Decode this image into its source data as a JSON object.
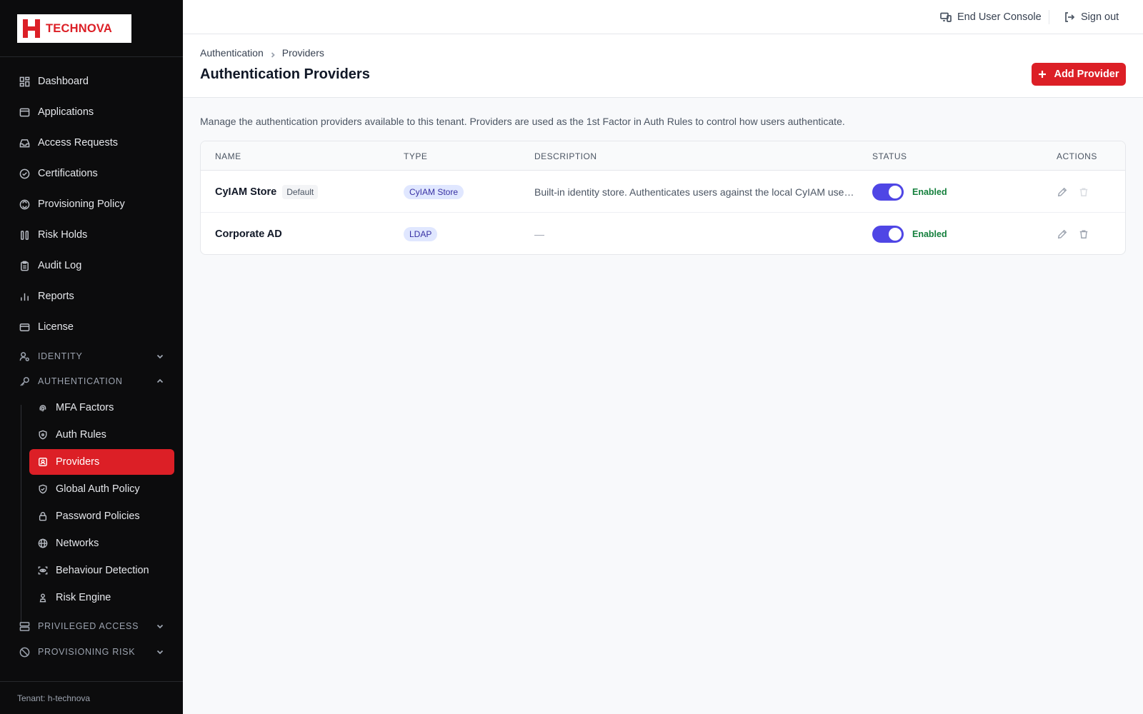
{
  "brand": {
    "name": "TECHNOVA",
    "color": "#dc1f26"
  },
  "sidebar": {
    "items": [
      {
        "label": "Dashboard",
        "icon": "dashboard-icon"
      },
      {
        "label": "Applications",
        "icon": "app-window-icon"
      },
      {
        "label": "Access Requests",
        "icon": "inbox-icon"
      },
      {
        "label": "Certifications",
        "icon": "check-circle-icon"
      },
      {
        "label": "Provisioning Policy",
        "icon": "policy-icon"
      },
      {
        "label": "Risk Holds",
        "icon": "pause-icon"
      },
      {
        "label": "Audit Log",
        "icon": "clipboard-icon"
      },
      {
        "label": "Reports",
        "icon": "bar-chart-icon"
      },
      {
        "label": "License",
        "icon": "card-icon"
      }
    ],
    "sections": [
      {
        "label": "IDENTITY",
        "icon": "user-cog-icon",
        "expanded": false
      },
      {
        "label": "AUTHENTICATION",
        "icon": "key-icon",
        "expanded": true
      },
      {
        "label": "PRIVILEGED ACCESS",
        "icon": "server-icon",
        "expanded": false
      },
      {
        "label": "PROVISIONING RISK",
        "icon": "shield-off-icon",
        "expanded": false
      }
    ],
    "auth_items": [
      {
        "label": "MFA Factors",
        "icon": "fingerprint-icon"
      },
      {
        "label": "Auth Rules",
        "icon": "shield-icon"
      },
      {
        "label": "Providers",
        "icon": "id-card-icon",
        "active": true
      },
      {
        "label": "Global Auth Policy",
        "icon": "shield-check-icon"
      },
      {
        "label": "Password Policies",
        "icon": "lock-icon"
      },
      {
        "label": "Networks",
        "icon": "globe-icon"
      },
      {
        "label": "Behaviour Detection",
        "icon": "scan-eye-icon"
      },
      {
        "label": "Risk Engine",
        "icon": "engine-icon"
      }
    ],
    "tenant": "Tenant: h-technova"
  },
  "topbar": {
    "console_label": "End User Console",
    "signout_label": "Sign out"
  },
  "header": {
    "breadcrumb": [
      "Authentication",
      "Providers"
    ],
    "title": "Authentication Providers",
    "add_label": "Add Provider"
  },
  "main": {
    "description": "Manage the authentication providers available to this tenant. Providers are used as the 1st Factor in Auth Rules to control how users authenticate.",
    "columns": [
      "NAME",
      "TYPE",
      "DESCRIPTION",
      "STATUS",
      "ACTIONS"
    ],
    "rows": [
      {
        "name": "CyIAM Store",
        "badge": "Default",
        "type": "CyIAM Store",
        "description": "Built-in identity store. Authenticates users against the local CyIAM user directory.",
        "status": "Enabled",
        "enabled": true,
        "deletable": false
      },
      {
        "name": "Corporate AD",
        "badge": "",
        "type": "LDAP",
        "description": "—",
        "status": "Enabled",
        "enabled": true,
        "deletable": true
      }
    ]
  },
  "colors": {
    "accent": "#dc1f26",
    "toggle": "#4f46e5",
    "enabled_text": "#15803d",
    "badge_bg": "#e0e7ff",
    "badge_text": "#3730a3"
  }
}
